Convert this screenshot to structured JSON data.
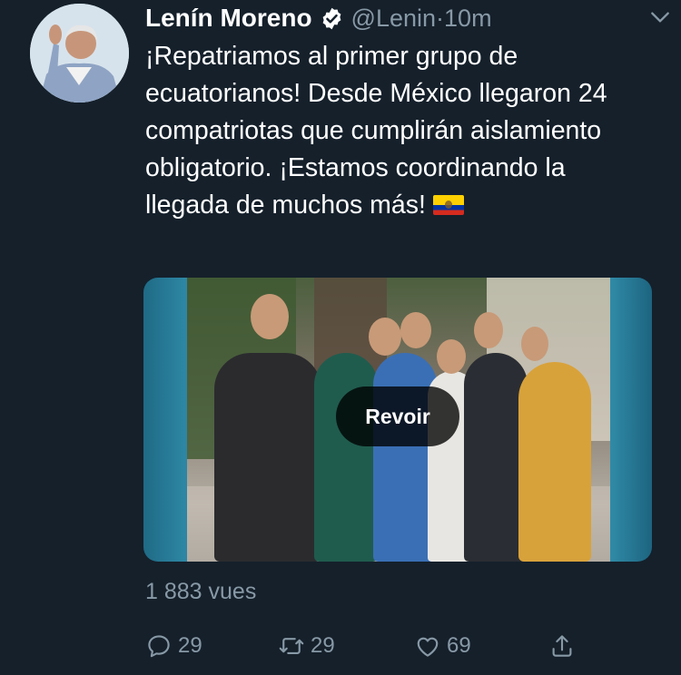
{
  "tweet": {
    "author_name": "Lenín Moreno",
    "handle": "@Lenin",
    "separator": " · ",
    "time": "10m",
    "text": "¡Repatriamos al primer grupo de ecuatorianos! Desde México llegaron 24 compatriotas que cumplirán aislamiento obligatorio. ¡Estamos coordinando la llegada de muchos más!",
    "flag_emoji": "ecuador-flag",
    "media": {
      "replay_label": "Revoir"
    },
    "views": "1 883 vues",
    "stats": {
      "replies": "29",
      "retweets": "29",
      "likes": "69"
    }
  },
  "colors": {
    "background": "#15202b",
    "text": "#ffffff",
    "secondary": "#8899a6",
    "verified": "#ffffff"
  },
  "icons": {
    "verified": "verified-badge-icon",
    "menu": "chevron-down-icon",
    "reply": "reply-bubble-icon",
    "retweet": "retweet-icon",
    "like": "heart-icon",
    "share": "share-upload-icon"
  }
}
